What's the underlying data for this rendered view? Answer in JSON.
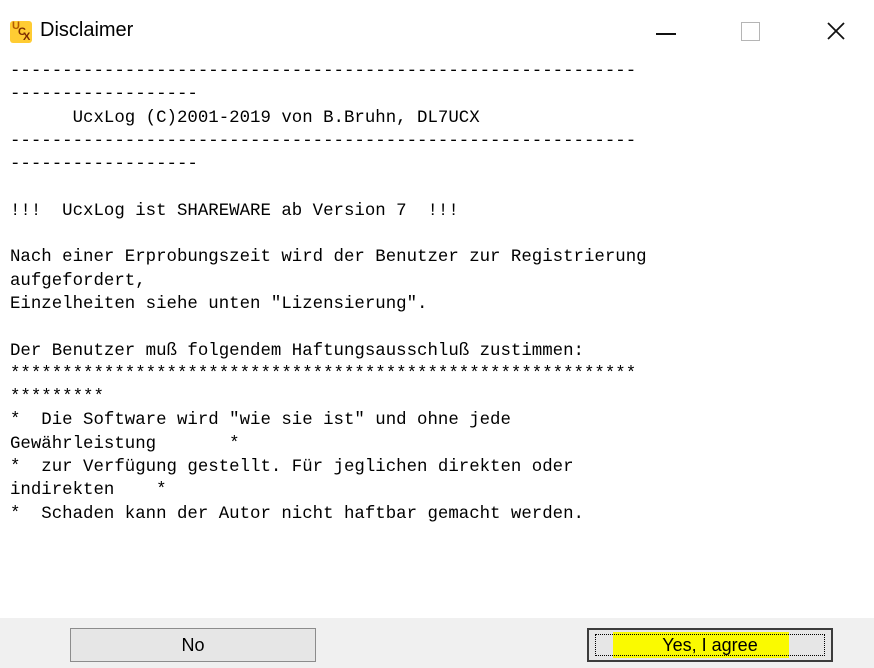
{
  "window": {
    "title": "Disclaimer",
    "app_icon_letters": [
      "U",
      "C",
      "X"
    ],
    "controls": {
      "minimize": "minimize-icon",
      "maximize": "maximize-icon",
      "close": "close-icon"
    }
  },
  "content": {
    "lines": [
      "------------------------------------------------------------",
      "------------------",
      "      UcxLog (C)2001-2019 von B.Bruhn, DL7UCX",
      "------------------------------------------------------------",
      "------------------",
      "",
      "!!!  UcxLog ist SHAREWARE ab Version 7  !!!",
      "",
      "Nach einer Erprobungszeit wird der Benutzer zur Registrierung",
      "aufgefordert,",
      "Einzelheiten siehe unten \"Lizensierung\".",
      "",
      "Der Benutzer muß folgendem Haftungsausschluß zustimmen:",
      "************************************************************",
      "*********",
      "*  Die Software wird \"wie sie ist\" und ohne jede",
      "Gewährleistung       *",
      "*  zur Verfügung gestellt. Für jeglichen direkten oder",
      "indirekten    *",
      "*  Schaden kann der Autor nicht haftbar gemacht werden."
    ]
  },
  "buttons": {
    "no_label": "No",
    "yes_label": "Yes, I agree",
    "yes_highlight_color": "#fafa00"
  }
}
